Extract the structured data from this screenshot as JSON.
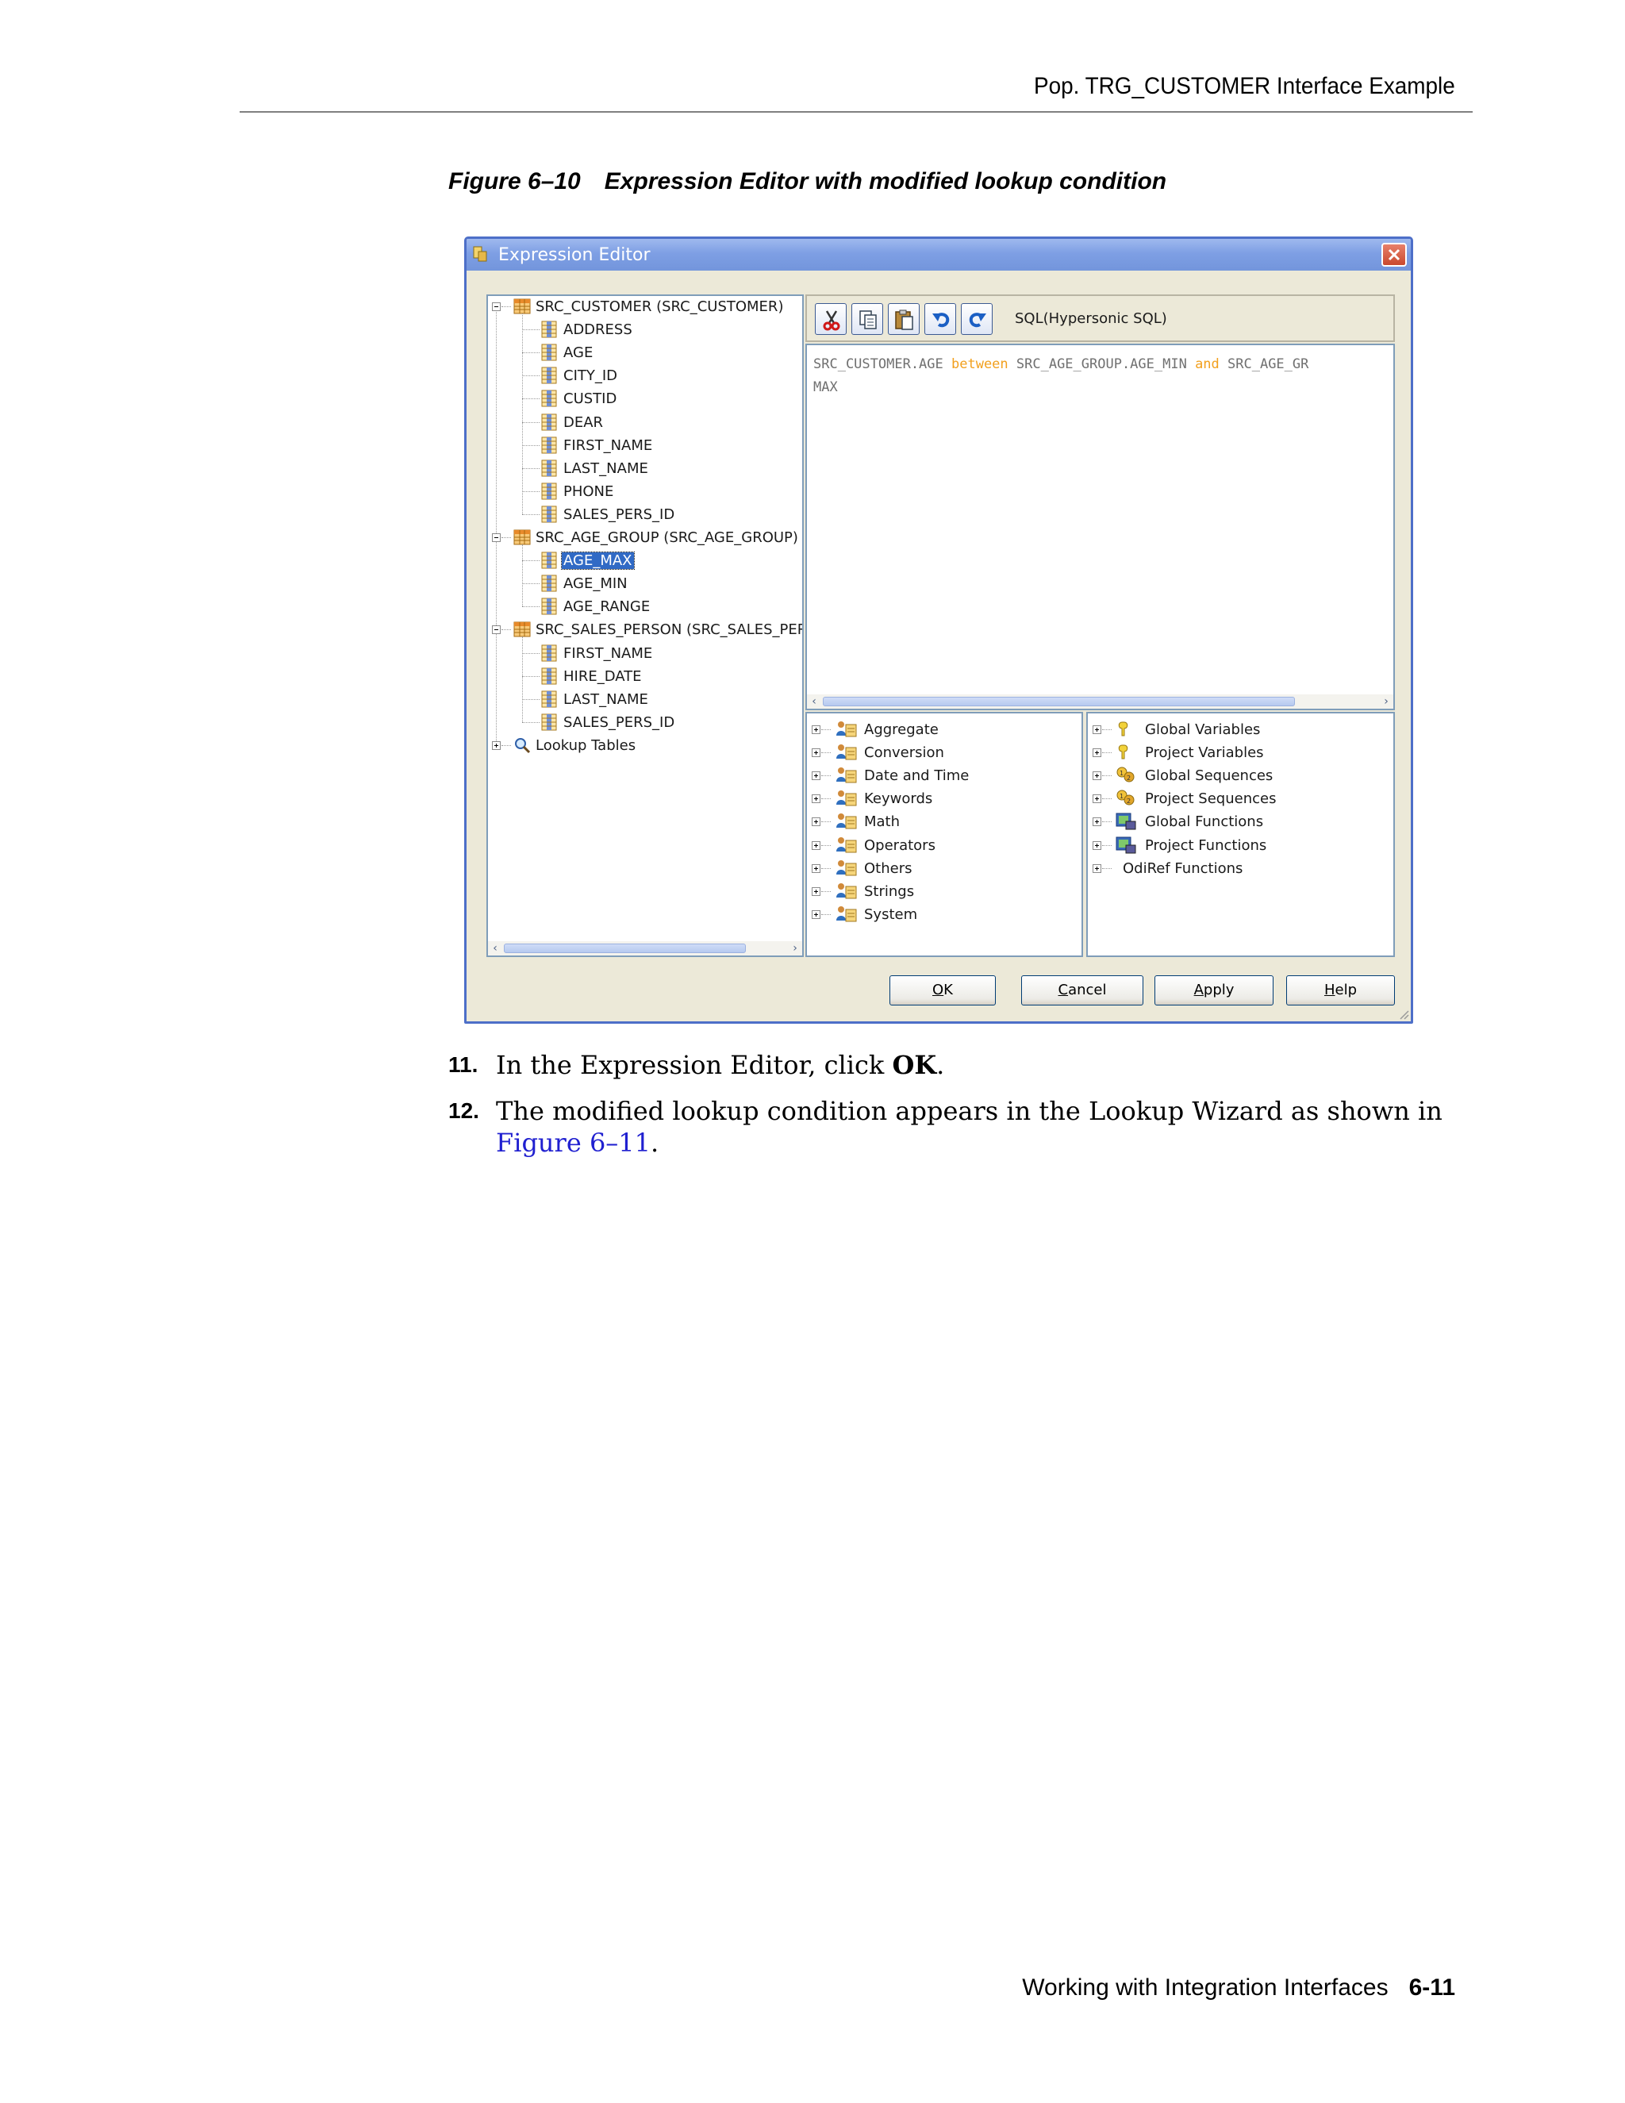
{
  "page": {
    "running_header": "Pop. TRG_CUSTOMER Interface Example",
    "figure_number": "Figure 6–10",
    "figure_title": "Expression Editor with modified lookup condition",
    "footer_section": "Working with Integration Interfaces",
    "footer_page": "6-11"
  },
  "dialog": {
    "title": "Expression Editor",
    "tree": {
      "nodes": [
        {
          "label": "SRC_CUSTOMER (SRC_CUSTOMER)",
          "level": 0,
          "kind": "table"
        },
        {
          "label": "ADDRESS",
          "level": 1,
          "kind": "column"
        },
        {
          "label": "AGE",
          "level": 1,
          "kind": "column"
        },
        {
          "label": "CITY_ID",
          "level": 1,
          "kind": "column"
        },
        {
          "label": "CUSTID",
          "level": 1,
          "kind": "column"
        },
        {
          "label": "DEAR",
          "level": 1,
          "kind": "column"
        },
        {
          "label": "FIRST_NAME",
          "level": 1,
          "kind": "column"
        },
        {
          "label": "LAST_NAME",
          "level": 1,
          "kind": "column"
        },
        {
          "label": "PHONE",
          "level": 1,
          "kind": "column"
        },
        {
          "label": "SALES_PERS_ID",
          "level": 1,
          "kind": "column"
        },
        {
          "label": "SRC_AGE_GROUP (SRC_AGE_GROUP)",
          "level": 0,
          "kind": "table"
        },
        {
          "label": "AGE_MAX",
          "level": 1,
          "kind": "column",
          "selected": true
        },
        {
          "label": "AGE_MIN",
          "level": 1,
          "kind": "column"
        },
        {
          "label": "AGE_RANGE",
          "level": 1,
          "kind": "column"
        },
        {
          "label": "SRC_SALES_PERSON (SRC_SALES_PER",
          "level": 0,
          "kind": "table"
        },
        {
          "label": "FIRST_NAME",
          "level": 1,
          "kind": "column"
        },
        {
          "label": "HIRE_DATE",
          "level": 1,
          "kind": "column"
        },
        {
          "label": "LAST_NAME",
          "level": 1,
          "kind": "column"
        },
        {
          "label": "SALES_PERS_ID",
          "level": 1,
          "kind": "column"
        },
        {
          "label": "Lookup Tables",
          "level": 0,
          "kind": "lookup"
        }
      ]
    },
    "toolbar": {
      "buttons": [
        "cut-icon",
        "copy-icon",
        "paste-icon",
        "undo-icon",
        "redo-icon"
      ],
      "dialect": "SQL(Hypersonic SQL)"
    },
    "editor": {
      "line1": {
        "a": "SRC_CUSTOMER.AGE ",
        "k1": "between",
        "b": " SRC_AGE_GROUP.AGE_MIN ",
        "k2": "and",
        "c": " SRC_AGE_GR"
      },
      "line2": "MAX"
    },
    "function_groups": [
      "Aggregate",
      "Conversion",
      "Date and Time",
      "Keywords",
      "Math",
      "Operators",
      "Others",
      "Strings",
      "System"
    ],
    "variable_groups": [
      {
        "label": "Global Variables",
        "icon": "variable-icon"
      },
      {
        "label": "Project Variables",
        "icon": "variable-icon"
      },
      {
        "label": "Global Sequences",
        "icon": "sequence-icon"
      },
      {
        "label": "Project Sequences",
        "icon": "sequence-icon"
      },
      {
        "label": "Global Functions",
        "icon": "function-icon"
      },
      {
        "label": "Project Functions",
        "icon": "function-icon"
      },
      {
        "label": "OdiRef Functions",
        "icon": ""
      }
    ],
    "buttons": {
      "ok": {
        "mnemonic": "O",
        "rest": "K"
      },
      "cancel": {
        "mnemonic": "C",
        "rest": "ancel"
      },
      "apply": {
        "mnemonic": "A",
        "rest": "pply"
      },
      "help": {
        "mnemonic": "H",
        "rest": "elp"
      }
    },
    "colors": {
      "selection": "#316ac5",
      "keyword": "#f2a01e",
      "titlebar": "#7e9fe4"
    }
  },
  "steps": [
    {
      "number": "11.",
      "text_before": "In the Expression Editor, click ",
      "bold": "OK",
      "text_after": "."
    },
    {
      "number": "12.",
      "text_before": " The modified lookup condition appears in the Lookup Wizard as shown in ",
      "link": "Figure 6–11",
      "text_after": "."
    }
  ]
}
